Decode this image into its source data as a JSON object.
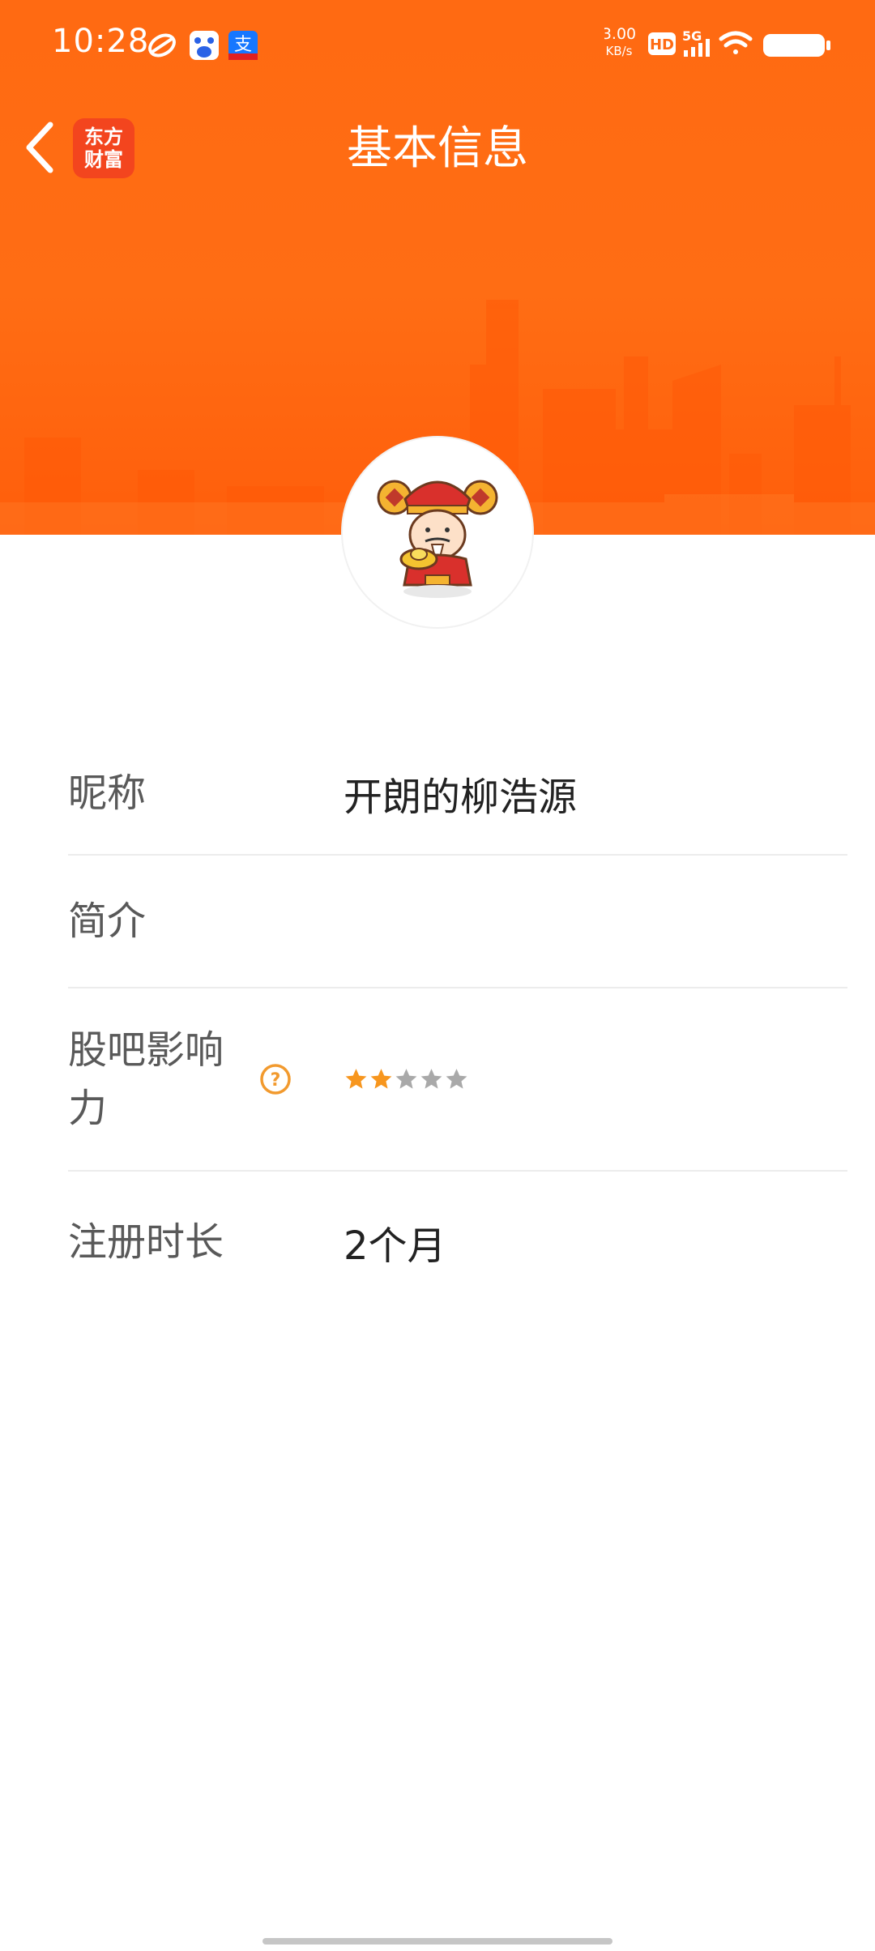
{
  "status_bar": {
    "time": "10:28",
    "net_speed_value": "3.00",
    "net_speed_unit": "KB/s",
    "hd_badge": "HD",
    "network": "5G",
    "left_icons": [
      "sync-icon",
      "baidu-icon",
      "alipay-icon"
    ],
    "right_icons": [
      "hd-icon",
      "signal-icon",
      "wifi-icon",
      "battery-icon"
    ]
  },
  "nav": {
    "title": "基本信息",
    "logo_line1": "东方",
    "logo_line2": "财富",
    "back_icon": "back-chevron-icon"
  },
  "profile": {
    "avatar": "caishen-mascot-avatar"
  },
  "info": {
    "nickname_label": "昵称",
    "nickname_value": "开朗的柳浩源",
    "intro_label": "简介",
    "intro_value": "",
    "influence_label_line1": "股吧影响",
    "influence_label_line2": "力",
    "influence_rating": 2,
    "influence_max": 5,
    "registration_label": "注册时长",
    "registration_value": "2个月"
  },
  "colors": {
    "header": "#ff6a12",
    "star_active": "#f7961e",
    "star_inactive": "#a9a9a9",
    "help_icon": "#f29a2e",
    "logo_bg": "#f3451e"
  }
}
